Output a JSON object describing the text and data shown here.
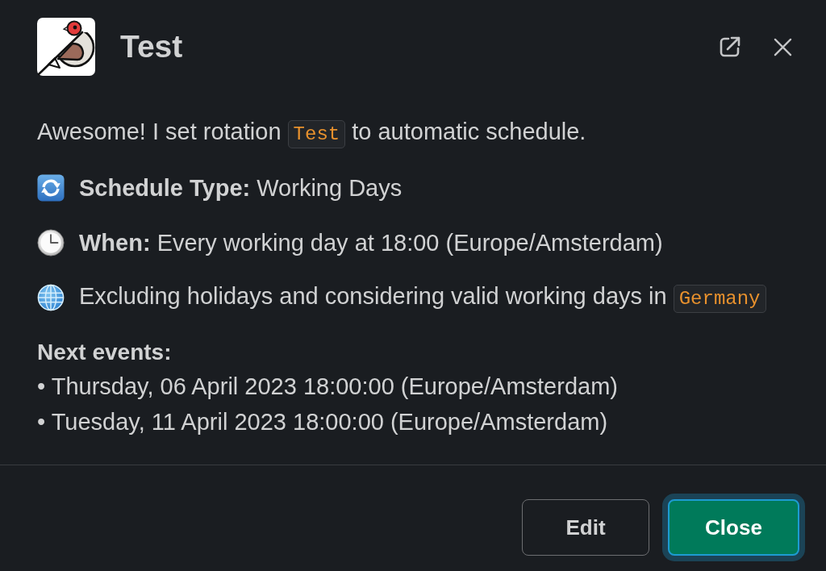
{
  "header": {
    "title": "Test"
  },
  "intro": {
    "parts": [
      {
        "kind": "plain",
        "text": "Awesome! I set rotation"
      },
      {
        "kind": "code",
        "text": "Test"
      },
      {
        "kind": "plain",
        "text": "to automatic schedule."
      }
    ]
  },
  "schedule_type": {
    "parts": [
      {
        "kind": "plain",
        "text": "**Schedule Type:** Working Days"
      }
    ]
  },
  "when": {
    "parts": [
      {
        "kind": "plain",
        "text": "**When:** Every working day at 18:00 (Europe/Amsterdam)"
      }
    ]
  },
  "holidays": {
    "parts": [
      {
        "kind": "plain",
        "text": "Excluding holidays and considering valid working days in"
      },
      {
        "kind": "code",
        "text": "Germany"
      }
    ]
  },
  "next_events": {
    "heading": "Next events:",
    "items": [
      "• Thursday, 06 April 2023 18:00:00 (Europe/Amsterdam)",
      "• Tuesday, 11 April 2023 18:00:00 (Europe/Amsterdam)"
    ]
  },
  "buttons": [
    {
      "label": "Edit",
      "kind": "secondary",
      "focused": false
    },
    {
      "label": "Close",
      "kind": "primary",
      "focused": true
    }
  ]
}
